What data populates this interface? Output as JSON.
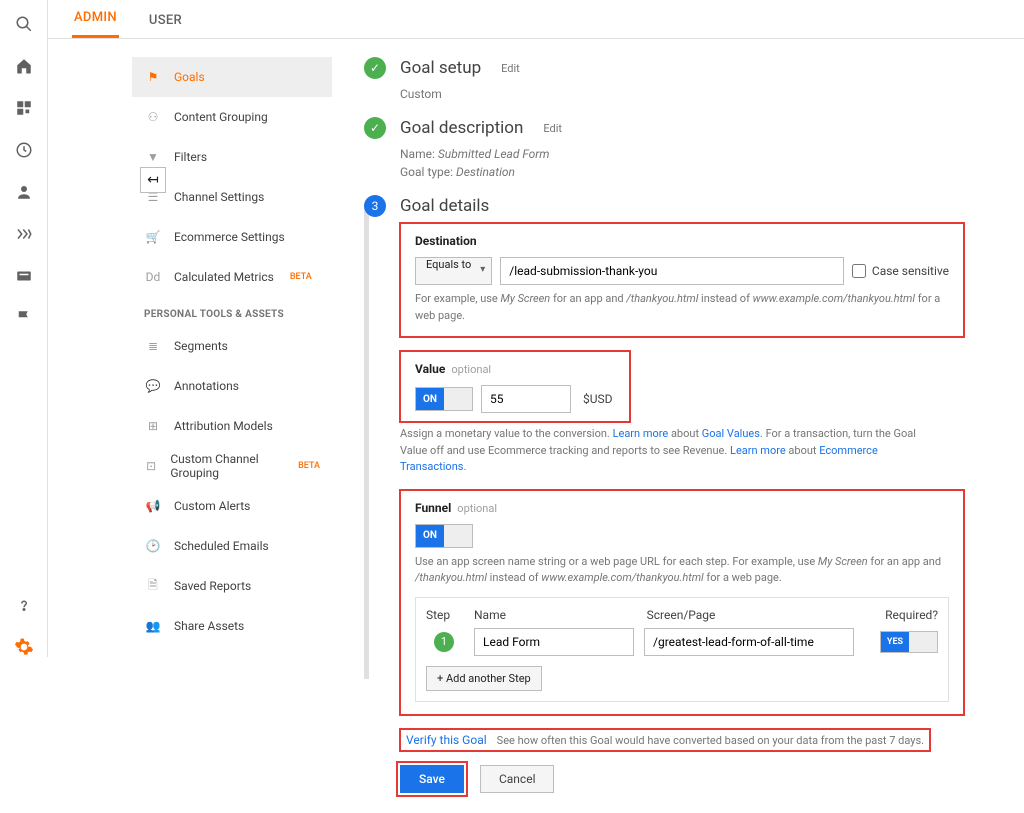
{
  "tabs": {
    "admin": "ADMIN",
    "user": "USER"
  },
  "sidebar": {
    "items": [
      {
        "label": "Goals"
      },
      {
        "label": "Content Grouping"
      },
      {
        "label": "Filters"
      },
      {
        "label": "Channel Settings"
      },
      {
        "label": "Ecommerce Settings"
      },
      {
        "label": "Calculated Metrics"
      }
    ],
    "heading": "PERSONAL TOOLS & ASSETS",
    "tools": [
      {
        "label": "Segments"
      },
      {
        "label": "Annotations"
      },
      {
        "label": "Attribution Models"
      },
      {
        "label": "Custom Channel Grouping"
      },
      {
        "label": "Custom Alerts"
      },
      {
        "label": "Scheduled Emails"
      },
      {
        "label": "Saved Reports"
      },
      {
        "label": "Share Assets"
      }
    ],
    "beta": "BETA"
  },
  "steps": {
    "setup": {
      "title": "Goal setup",
      "edit": "Edit",
      "sub": "Custom"
    },
    "desc": {
      "title": "Goal description",
      "edit": "Edit",
      "name_label": "Name:",
      "name_value": "Submitted Lead Form",
      "type_label": "Goal type:",
      "type_value": "Destination"
    },
    "details": {
      "title": "Goal details",
      "num": "3"
    }
  },
  "destination": {
    "heading": "Destination",
    "match": "Equals to",
    "value": "/lead-submission-thank-you",
    "case_label": "Case sensitive",
    "help_pre": "For example, use ",
    "help_em1": "My Screen",
    "help_mid": " for an app and ",
    "help_em2": "/thankyou.html",
    "help_mid2": " instead of ",
    "help_em3": "www.example.com/thankyou.html",
    "help_end": " for a web page."
  },
  "value": {
    "heading": "Value",
    "optional": "optional",
    "on": "ON",
    "amount": "55",
    "currency": "$USD",
    "help1": "Assign a monetary value to the conversion. ",
    "help_link1": "Learn more",
    "help2": " about ",
    "help_link2": "Goal Values",
    "help3": ". For a transaction, turn the Goal Value off and use Ecommerce tracking and reports to see Revenue. ",
    "help_link3": "Learn more",
    "help4": " about ",
    "help_link4": "Ecommerce Transactions",
    "help5": "."
  },
  "funnel": {
    "heading": "Funnel",
    "optional": "optional",
    "on": "ON",
    "help1": "Use an app screen name string or a web page URL for each step. For example, use ",
    "help_em1": "My Screen",
    "help2": " for an app and ",
    "help_em2": "/thankyou.html",
    "help3": " instead of ",
    "help_em3": "www.example.com/thankyou.html",
    "help4": " for a web page.",
    "col_step": "Step",
    "col_name": "Name",
    "col_page": "Screen/Page",
    "col_req": "Required?",
    "row_name": "Lead Form",
    "row_page": "/greatest-lead-form-of-all-time",
    "yes": "YES",
    "add": "+ Add another Step"
  },
  "verify": {
    "link": "Verify this Goal",
    "text": "See how often this Goal would have converted based on your data from the past 7 days."
  },
  "buttons": {
    "save": "Save",
    "cancel": "Cancel"
  }
}
